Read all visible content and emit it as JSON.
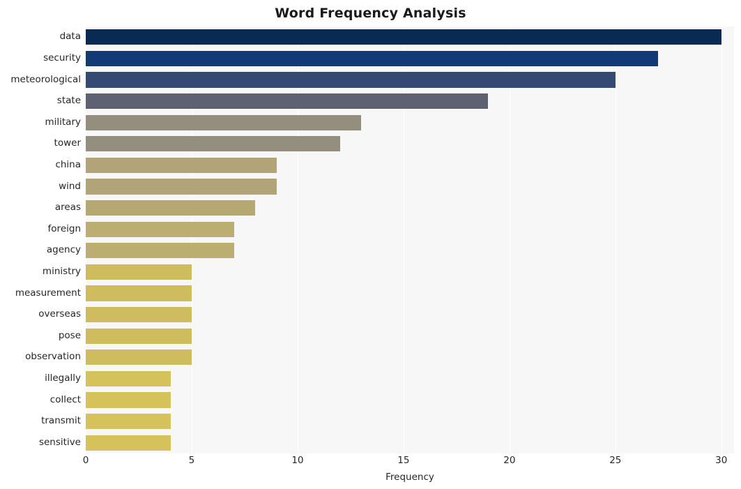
{
  "chart_data": {
    "type": "bar",
    "orientation": "horizontal",
    "title": "Word Frequency Analysis",
    "xlabel": "Frequency",
    "ylabel": "",
    "xlim": [
      0,
      30.6
    ],
    "xticks": [
      0,
      5,
      10,
      15,
      20,
      25,
      30
    ],
    "grid": "vertical",
    "legend": "none",
    "categories": [
      "data",
      "security",
      "meteorological",
      "state",
      "military",
      "tower",
      "china",
      "wind",
      "areas",
      "foreign",
      "agency",
      "ministry",
      "measurement",
      "overseas",
      "pose",
      "observation",
      "illegally",
      "collect",
      "transmit",
      "sensitive"
    ],
    "values": [
      30,
      27,
      25,
      19,
      13,
      12,
      9,
      9,
      8,
      7,
      7,
      5,
      5,
      5,
      5,
      5,
      4,
      4,
      4,
      4
    ],
    "bar_colors": [
      "#082a54",
      "#123b75",
      "#354a72",
      "#5d6172",
      "#938e7e",
      "#938e7e",
      "#b0a478",
      "#b0a478",
      "#b6a873",
      "#bcae70",
      "#bcae70",
      "#cfbc5f",
      "#cfbc5f",
      "#cfbc5f",
      "#cfbc5f",
      "#cfbc5f",
      "#d6c25a",
      "#d6c25a",
      "#d6c25a",
      "#d6c25a"
    ]
  },
  "style": {
    "plot_background": "#f7f7f7",
    "page_background": "#ffffff",
    "grid_color": "#ffffff",
    "text_color": "#262626",
    "title_color": "#1a1a1a"
  }
}
